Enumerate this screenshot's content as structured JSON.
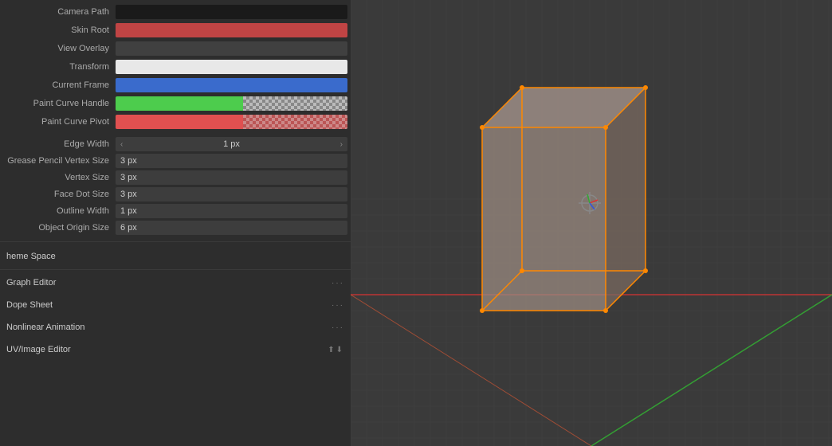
{
  "left_panel": {
    "color_rows": [
      {
        "label": "Camera Path",
        "color": "#1a1a1a",
        "type": "solid"
      },
      {
        "label": "Skin Root",
        "color": "#c04444",
        "type": "solid"
      },
      {
        "label": "View Overlay",
        "color": "#3a3a3a",
        "type": "solid"
      },
      {
        "label": "Transform",
        "color": "#e8e8e8",
        "type": "solid"
      },
      {
        "label": "Current Frame",
        "color": "#3a6bcc",
        "type": "solid"
      },
      {
        "label": "Paint Curve Handle",
        "color": "special_green_checker",
        "type": "split_checker"
      },
      {
        "label": "Paint Curve Pivot",
        "color": "special_red_checker",
        "type": "split_checker_red"
      }
    ],
    "number_rows": [
      {
        "label": "Edge Width",
        "value": "1 px",
        "has_arrows": true
      },
      {
        "label": "Grease Pencil Vertex Size",
        "value": "3 px",
        "has_arrows": false
      },
      {
        "label": "Vertex Size",
        "value": "3 px",
        "has_arrows": false
      },
      {
        "label": "Face Dot Size",
        "value": "3 px",
        "has_arrows": false
      },
      {
        "label": "Outline Width",
        "value": "1 px",
        "has_arrows": false
      },
      {
        "label": "Object Origin Size",
        "value": "6 px",
        "has_arrows": false
      }
    ],
    "theme_section": {
      "items": [
        {
          "label": "heme Space",
          "has_dots": false
        },
        {
          "label": "Graph Editor",
          "has_dots": true
        },
        {
          "label": "Dope Sheet",
          "has_dots": true
        },
        {
          "label": "Nonlinear Animation",
          "has_dots": true
        },
        {
          "label": "UV/Image Editor",
          "has_dots": true,
          "special": true
        }
      ]
    }
  },
  "viewport": {
    "bg_color": "#3a3a3a"
  }
}
